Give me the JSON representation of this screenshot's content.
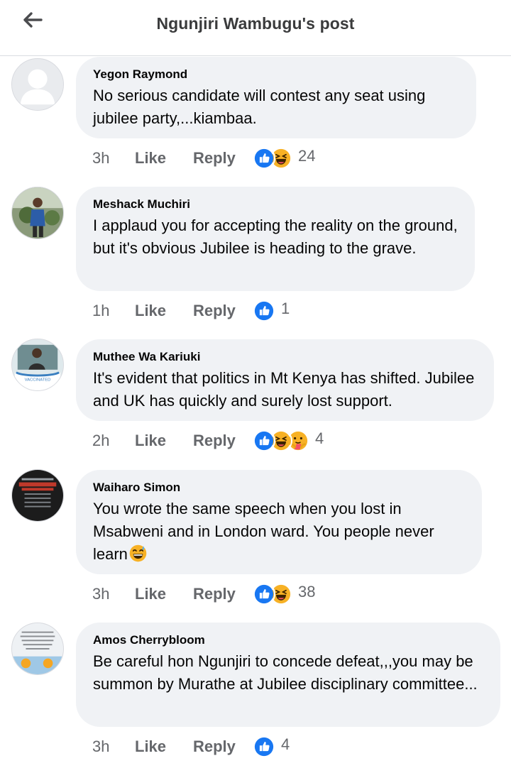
{
  "header": {
    "title": "Ngunjiri Wambugu's post"
  },
  "actions": {
    "like": "Like",
    "reply": "Reply"
  },
  "colors": {
    "like_blue": "#1877f2",
    "haha_yellow": "#f7b125",
    "bubble": "#f0f2f5",
    "meta": "#65676b"
  },
  "comments": [
    {
      "author": "Yegon Raymond",
      "text": "No serious candidate will contest any seat using jubilee party,...kiambaa.",
      "time": "3h",
      "reactions": [
        "like-icon",
        "haha-icon"
      ],
      "count": "24",
      "avatar": "default-avatar"
    },
    {
      "author": "Meshack Muchiri",
      "text": "I applaud you for accepting the reality on the ground, but it's obvious Jubilee is heading to the grave.",
      "time": "1h",
      "reactions": [
        "like-icon"
      ],
      "count": "1",
      "avatar": "photo-avatar"
    },
    {
      "author": "Muthee Wa Kariuki",
      "text": "It's evident that politics in Mt Kenya has shifted. Jubilee and UK has quickly and surely lost support.",
      "time": "2h",
      "reactions": [
        "like-icon",
        "haha-icon",
        "care-icon"
      ],
      "count": "4",
      "avatar": "vaccinated-frame-avatar"
    },
    {
      "author": "Waiharo Simon",
      "text": "You wrote the same speech when you lost in Msabweni and in London ward. You people never learn",
      "time": "3h",
      "reactions": [
        "like-icon",
        "haha-icon"
      ],
      "count": "38",
      "avatar": "poster-avatar"
    },
    {
      "author": "Amos Cherrybloom",
      "text": "Be careful hon Ngunjiri to concede defeat,,,you may be summon by Murathe at Jubilee disciplinary committee...",
      "time": "3h",
      "reactions": [
        "like-icon"
      ],
      "count": "4",
      "avatar": "quote-avatar"
    }
  ]
}
